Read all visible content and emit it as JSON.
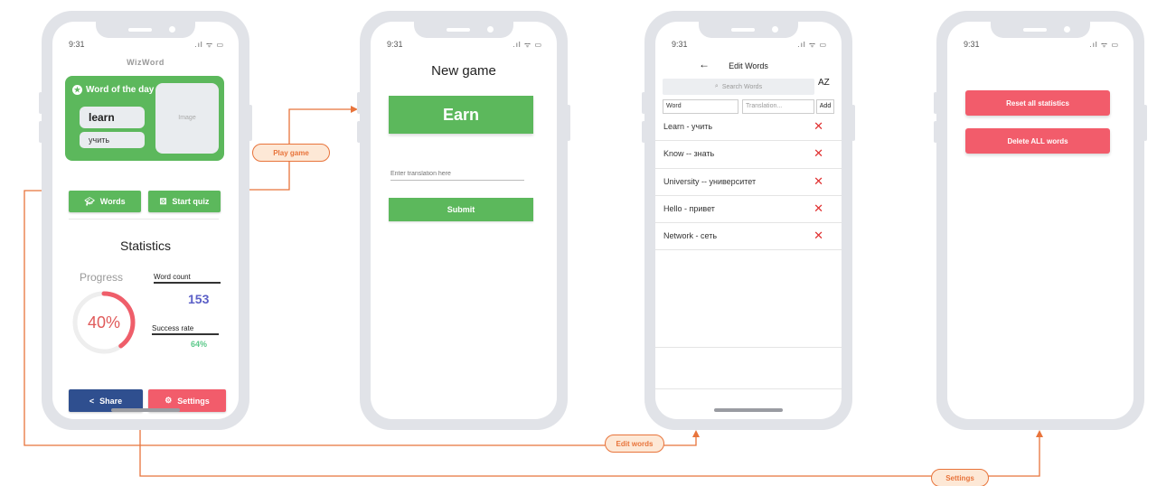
{
  "status": {
    "time": "9:31",
    "icons": ".ıl ᯤ ▭"
  },
  "home": {
    "app_name": "WizWord",
    "word_of_day": {
      "title": "Word of the day",
      "word": "learn",
      "translation": "учить",
      "image_label": "Image"
    },
    "buttons": {
      "words": "Words",
      "start_quiz": "Start quiz",
      "share": "Share",
      "settings": "Settings"
    },
    "statistics": {
      "title": "Statistics",
      "progress_label": "Progress",
      "progress_percent": 40,
      "progress_text": "40%",
      "word_count_label": "Word count",
      "word_count": "153",
      "success_rate_label": "Success rate",
      "success_rate": "64%"
    }
  },
  "new_game": {
    "title": "New game",
    "word": "Earn",
    "input_placeholder": "Enter translation here",
    "submit_label": "Submit"
  },
  "edit_words": {
    "back": "←",
    "title": "Edit Words",
    "search_placeholder": "Search Words",
    "sort_icon": "AZ",
    "word_field": "Word",
    "translation_placeholder": "Translation...",
    "add_label": "Add",
    "words": [
      {
        "text": "Learn - учить"
      },
      {
        "text": "Know -- знать"
      },
      {
        "text": "University -- университет"
      },
      {
        "text": "Hello - привет"
      },
      {
        "text": "Network - сеть"
      }
    ],
    "delete_icon": "✕"
  },
  "settings": {
    "reset_label": "Reset all statistics",
    "delete_label": "Delete ALL words"
  },
  "flow_labels": {
    "play_game": "Play game",
    "edit_words": "Edit words",
    "settings": "Settings"
  },
  "colors": {
    "green": "#5cb85c",
    "red": "#f25c6b",
    "blue": "#2f4f8f",
    "connector": "#e8743b",
    "word_count": "#5b5fc7",
    "success": "#5cc98a"
  }
}
